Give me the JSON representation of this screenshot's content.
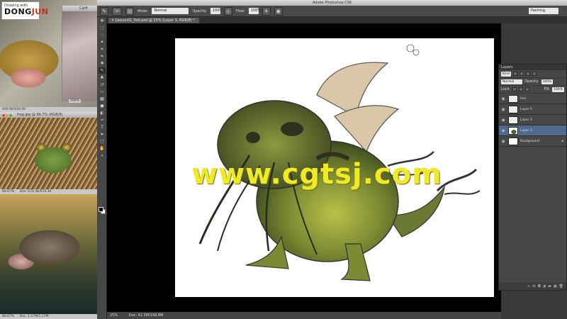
{
  "app": {
    "title": "Adobe Photoshop CS6"
  },
  "left_windows": {
    "fish1": {
      "title": "Catfi",
      "status_left": "930.0K/930.0K",
      "inset_zoom": "200%"
    },
    "frog": {
      "title": "frog.jpg @ 66.7% (RGB/8)",
      "zoom": "66.67%",
      "doc": "Doc: 670.3K/670.3K"
    },
    "catfish": {
      "zoom": "66.67%",
      "doc": "Doc: 1.17M/1.17M"
    },
    "logo": {
      "small": "Drawing with",
      "big_prefix": "DONG",
      "big_suffix": "JUN"
    }
  },
  "options": {
    "brush_size": "500",
    "mode_label": "Mode:",
    "mode_value": "Normal",
    "opacity_label": "Opacity:",
    "opacity_value": "100%",
    "flow_label": "Flow:",
    "flow_value": "100%",
    "workspace": "Painting"
  },
  "document": {
    "tab": "Lesson01_fish.psd @ 25% (Layer 3, RGB/8) *"
  },
  "canvas": {
    "watermark": "www.cgtsj.com"
  },
  "status": {
    "zoom": "25%",
    "doc": "Doc: 42.5M/158.8M"
  },
  "layers_panel": {
    "tab": "Layers",
    "kind": "Kind",
    "blend": "Normal",
    "opacity_label": "Opacity:",
    "opacity_value": "100%",
    "lock_label": "Lock:",
    "fill_label": "Fill:",
    "fill_value": "100%",
    "layers": [
      {
        "name": "line",
        "thumb": "trans",
        "selected": false
      },
      {
        "name": "Layer 5",
        "thumb": "trans",
        "selected": false
      },
      {
        "name": "Layer 4",
        "thumb": "trans",
        "selected": false
      },
      {
        "name": "Layer 3",
        "thumb": "art",
        "selected": true
      },
      {
        "name": "Background",
        "thumb": "white",
        "selected": false
      }
    ]
  },
  "colors": {
    "watermark": "#f0ea26",
    "creature": "#6b7a32",
    "selection": "#4e6a8c"
  }
}
